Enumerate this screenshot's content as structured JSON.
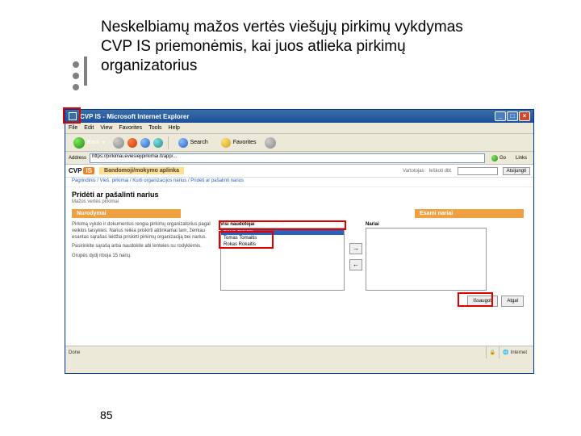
{
  "slide": {
    "title": "Neskelbiamų mažos vertės viešųjų pirkimų vykdymas\nCVP IS priemonėmis, kai juos atlieka pirkimų organizatorius",
    "page_number": "85"
  },
  "window": {
    "title": "CVP IS - Microsoft Internet Explorer",
    "menu": [
      "File",
      "Edit",
      "View",
      "Favorites",
      "Tools",
      "Help"
    ],
    "toolbar": {
      "back": "Back",
      "search": "Search",
      "favorites": "Favorites"
    },
    "address": {
      "label": "Address",
      "url": "https://pirkimai.eviesiejipirkimai.lt/app/...",
      "go": "Go",
      "links": "Links"
    },
    "status": {
      "done": "Done",
      "zone": "Internet"
    }
  },
  "page": {
    "logo": {
      "cvp": "CVP",
      "is": "IS"
    },
    "env": "Bandomoji/mokymo aplinka",
    "header": {
      "label1": "Vartotojas",
      "label2": "Ieškoti dbt.",
      "logout": "Atsijungti"
    },
    "breadcrumb": "Pagrindinis / Vieš. pirkimai / Kurti organizacijos narius / Pridėti ar pašalinti narius",
    "title": "Pridėti ar pašalinti narius",
    "subtitle": "Mažos vertės pirkimai",
    "columns": {
      "left": "Nurodymai",
      "right": "Esami nariai",
      "all": "Visi naudotojai",
      "selected": "Nariai"
    },
    "desc": {
      "p1": "Pirkimą vykdo ir dokumentus rengia pirkimų organizatorius pagal veiklos taisykles. Narius reikia priskirti atitinkamai tam, žemiau esantas sąrašas leidžia priskirti pirkimų organizaciją bei narius.",
      "p2": "Pasirinkite sąrašą arba naudokite abi lenteles su rodyklėmis.",
      "p3": "Grupės dydį riboja 15 narių."
    },
    "options_left": [
      "Euras Euraitis",
      "Tomas Tomaitis",
      "Rokas Rokaitis"
    ],
    "options_right": [],
    "actions": {
      "save": "Išsaugoti",
      "cancel": "Atgal"
    }
  }
}
